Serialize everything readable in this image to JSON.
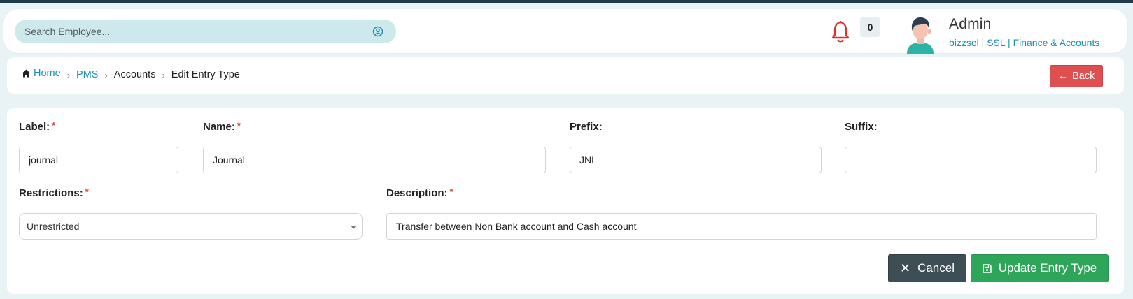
{
  "search": {
    "placeholder": "Search Employee..."
  },
  "notifications": {
    "count": "0"
  },
  "user": {
    "name": "Admin",
    "meta": "bizzsol | SSL  | Finance & Accounts"
  },
  "breadcrumb": {
    "home": "Home",
    "pms": "PMS",
    "accounts": "Accounts",
    "current": "Edit Entry Type"
  },
  "back_label": "Back",
  "form": {
    "label": {
      "title": "Label:",
      "value": "journal",
      "required": "*"
    },
    "name": {
      "title": "Name:",
      "value": "Journal",
      "required": "*"
    },
    "prefix": {
      "title": "Prefix:",
      "value": "JNL"
    },
    "suffix": {
      "title": "Suffix:",
      "value": ""
    },
    "restrictions": {
      "title": "Restrictions:",
      "value": "Unrestricted",
      "required": "*"
    },
    "description": {
      "title": "Description:",
      "value": "Transfer between Non Bank account and Cash account",
      "required": "*"
    }
  },
  "buttons": {
    "cancel": "Cancel",
    "update": "Update Entry Type"
  },
  "colors": {
    "accent": "#1a8fb0",
    "danger": "#e04f4f",
    "success": "#2ea65a",
    "dark": "#3d4f55"
  }
}
